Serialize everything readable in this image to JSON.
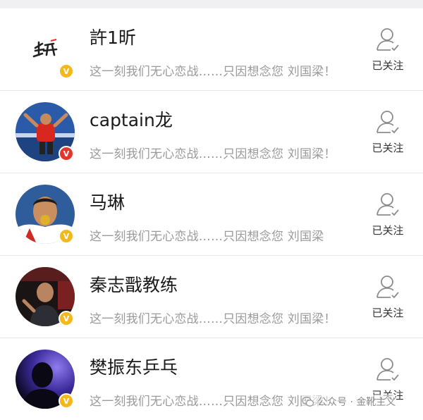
{
  "follow_list": [
    {
      "name": "許1昕",
      "description": "这一刻我们无心恋战……只因想念您 刘国梁！",
      "follow_label": "已关注",
      "avatar_content": "許 handwritten signature logo",
      "badge_color": "#f5b81c"
    },
    {
      "name": "captain龙",
      "description": "这一刻我们无心恋战……只因想念您 刘国梁！",
      "follow_label": "已关注",
      "avatar_content": "player in red shirt celebrating",
      "badge_color": "#e5362d"
    },
    {
      "name": "马琳",
      "description": "这一刻我们无心恋战……只因想念您 刘国梁",
      "follow_label": "已关注",
      "avatar_content": "player biting a gold medal",
      "badge_color": "#f5b81c"
    },
    {
      "name": "秦志戬教练",
      "description": "这一刻我们无心恋战……只因想念您 刘国梁！",
      "follow_label": "已关注",
      "avatar_content": "coach in dark setting",
      "badge_color": "#f5b81c"
    },
    {
      "name": "樊振东乒乓",
      "description": "这一刻我们无心恋战……只因想念您 刘国梁！",
      "follow_label": "已关注",
      "avatar_content": "silhouette against blue-purple light",
      "badge_color": "#f5b81c"
    }
  ],
  "watermark": {
    "text": "公众号 · 金靴主义",
    "icon": "wechat-icon"
  },
  "colors": {
    "name_text": "#1a1a1a",
    "description_text": "#9a9a9a",
    "badge_gold": "#f5b81c",
    "badge_red": "#e5362d",
    "divider": "#e6e6e6"
  }
}
